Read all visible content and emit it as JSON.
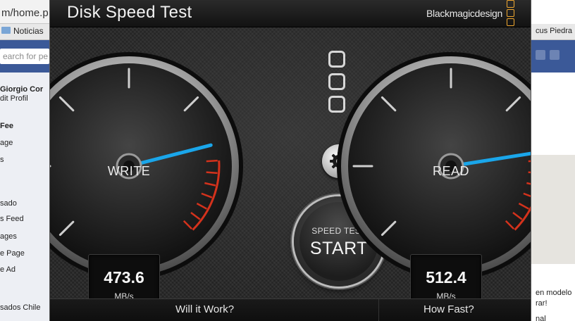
{
  "background_browser": {
    "left": {
      "url_fragment": "m/home.p",
      "bookmark": "Noticias",
      "search_placeholder": "earch for pe",
      "sidebar": [
        "Giorgio Cor",
        "dit Profil",
        "Fee",
        "age",
        "s",
        "sado",
        "s Feed",
        "ages",
        "e Page",
        "e Ad",
        "sados Chile"
      ]
    },
    "right": {
      "bookmark": "cus Piedra",
      "texts": [
        "en modelo",
        "rar!",
        "nal"
      ]
    }
  },
  "app": {
    "title": "Disk Speed Test",
    "brand": "Blackmagicdesign",
    "write_gauge": {
      "label": "WRITE",
      "value": "473.6",
      "unit": "MB/s",
      "needle_fraction": 0.78
    },
    "read_gauge": {
      "label": "READ",
      "value": "512.4",
      "unit": "MB/s",
      "needle_fraction": 0.8
    },
    "start_button": {
      "top_label": "SPEED TEST",
      "main_label": "START"
    },
    "settings_icon": "gear-icon",
    "bottom_bar": {
      "left_label": "Will it Work?",
      "right_label": "How Fast?"
    },
    "colors": {
      "needle": "#1aa6ea",
      "redline": "#d4321c",
      "accent": "#f0a830"
    }
  }
}
